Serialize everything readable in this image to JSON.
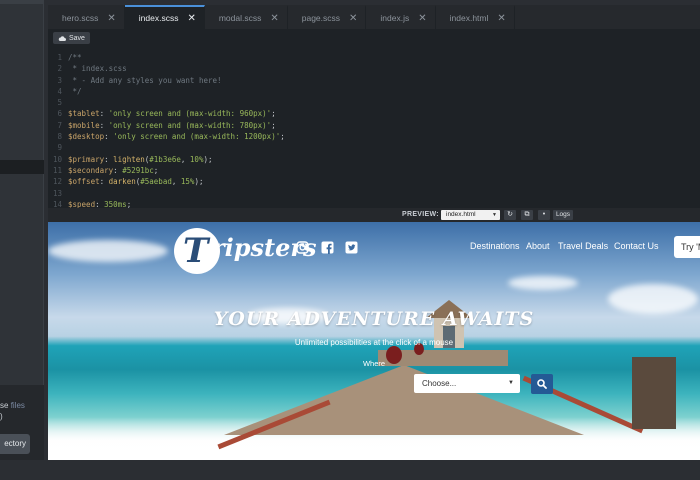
{
  "sidebar": {
    "text_line1_a": "se",
    "text_line1_b": "files",
    "text_line2": ")",
    "button_label": "ectory"
  },
  "editor": {
    "tabs": [
      {
        "label": "hero.scss",
        "active": false
      },
      {
        "label": "index.scss",
        "active": true
      },
      {
        "label": "modal.scss",
        "active": false
      },
      {
        "label": "page.scss",
        "active": false
      },
      {
        "label": "index.js",
        "active": false
      },
      {
        "label": "index.html",
        "active": false
      }
    ],
    "save_label": "Save",
    "code_lines": [
      {
        "n": "1",
        "text": "/**"
      },
      {
        "n": "2",
        "text": " * index.scss"
      },
      {
        "n": "3",
        "text": " * - Add any styles you want here!"
      },
      {
        "n": "4",
        "text": " */"
      },
      {
        "n": "5",
        "text": ""
      },
      {
        "n": "6",
        "text": "$tablet: 'only screen and (max-width: 960px)';"
      },
      {
        "n": "7",
        "text": "$mobile: 'only screen and (max-width: 780px)';"
      },
      {
        "n": "8",
        "text": "$desktop: 'only screen and (max-width: 1200px)';"
      },
      {
        "n": "9",
        "text": ""
      },
      {
        "n": "10",
        "text": "$primary: lighten(#1b3e6e, 10%);"
      },
      {
        "n": "11",
        "text": "$secondary: #5291bc;"
      },
      {
        "n": "12",
        "text": "$offset: darken(#5aebad, 15%);"
      },
      {
        "n": "13",
        "text": ""
      },
      {
        "n": "14",
        "text": "$speed: 350ms;"
      }
    ]
  },
  "preview_bar": {
    "label": "PREVIEW:",
    "selected_file": "index.html",
    "refresh_icon": "refresh-icon",
    "popout_icon": "external-link-icon",
    "dot_icon": "dot-icon",
    "logs_label": "Logs"
  },
  "site": {
    "logo_letter": "T",
    "logo_text": "ripsters",
    "social_icons": [
      "instagram-icon",
      "facebook-icon",
      "twitter-icon"
    ],
    "nav": [
      "Destinations",
      "About",
      "Travel Deals",
      "Contact Us"
    ],
    "search_partial": "Try 'M",
    "hero_title": "YOUR ADVENTURE AWAITS",
    "hero_subtitle": "Unlimited possibilities at the click of a mouse",
    "where_label": "Where",
    "select_value": "Choose...",
    "search_icon": "search-icon",
    "brand_blue": "#245a95"
  }
}
